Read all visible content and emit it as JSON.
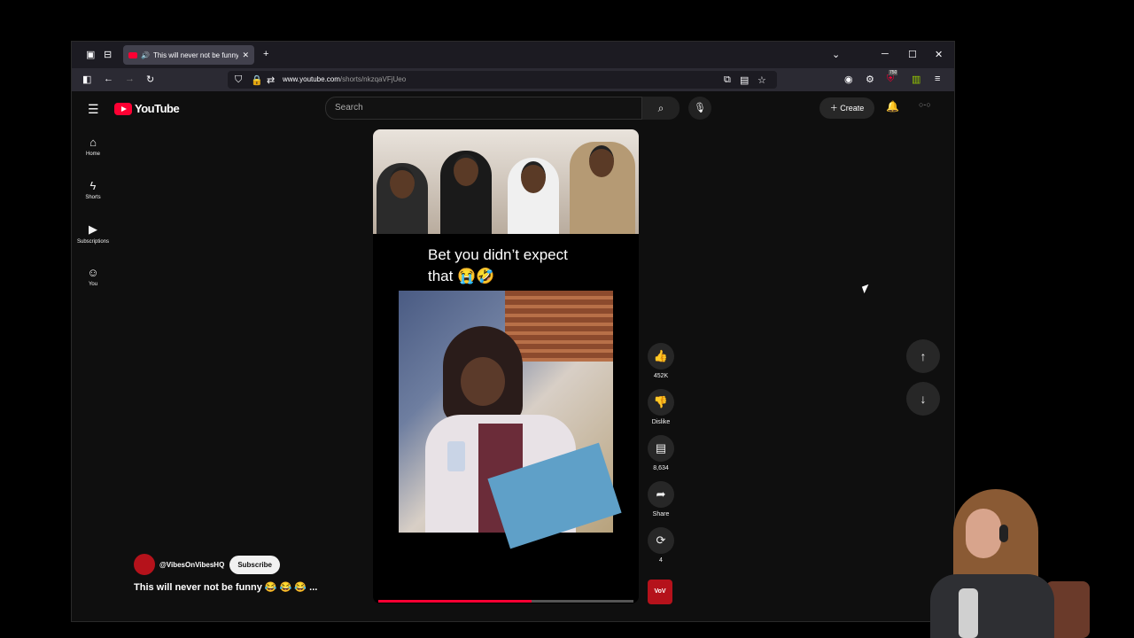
{
  "browser": {
    "tab_title": "This will never not be funny",
    "url_host": "www.youtube.com",
    "url_path": "/shorts/nkzqaVFjUeo",
    "badge_count": "750"
  },
  "header": {
    "logo_text": "YouTube",
    "search_placeholder": "Search",
    "create_label": "Create"
  },
  "sidebar": {
    "items": [
      {
        "label": "Home",
        "icon": "home-icon"
      },
      {
        "label": "Shorts",
        "icon": "shorts-icon"
      },
      {
        "label": "Subscriptions",
        "icon": "subscriptions-icon"
      },
      {
        "label": "You",
        "icon": "you-icon"
      }
    ]
  },
  "short": {
    "caption_line1": "Bet you didn’t expect",
    "caption_line2": "that 😭🤣",
    "progress_fraction": 0.6
  },
  "actions": {
    "like_count": "452K",
    "dislike_label": "Dislike",
    "comment_count": "8,634",
    "share_label": "Share",
    "remix_count": "4"
  },
  "channel": {
    "handle": "@VibesOnVibesHQ",
    "subscribe_label": "Subscribe",
    "video_title": "This will never not be funny 😂 😂 😂 ..."
  },
  "colors": {
    "accent": "#ff0033",
    "page_bg": "#0f0f0f",
    "chip_bg": "#272727"
  }
}
